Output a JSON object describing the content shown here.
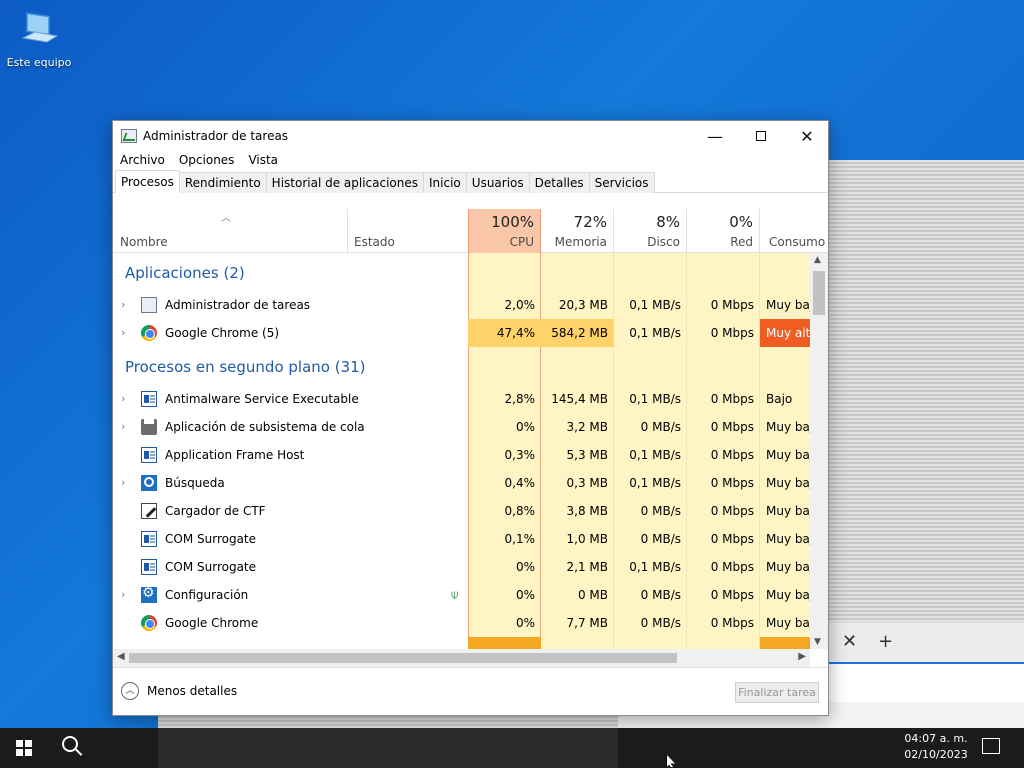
{
  "desktop": {
    "icon_label": "Este equipo"
  },
  "window": {
    "title": "Administrador de tareas",
    "min": "—",
    "close": "✕"
  },
  "menu": [
    "Archivo",
    "Opciones",
    "Vista"
  ],
  "tabs": [
    "Procesos",
    "Rendimiento",
    "Historial de aplicaciones",
    "Inicio",
    "Usuarios",
    "Detalles",
    "Servicios"
  ],
  "header": {
    "name": "Nombre",
    "estado": "Estado",
    "cpu_pct": "100%",
    "cpu": "CPU",
    "mem_pct": "72%",
    "mem": "Memoria",
    "disk_pct": "8%",
    "disk": "Disco",
    "net_pct": "0%",
    "net": "Red",
    "cons": "Consumo d"
  },
  "groups": {
    "apps": "Aplicaciones (2)",
    "bg": "Procesos en segundo plano (31)"
  },
  "apps": [
    {
      "name": "Administrador de tareas",
      "icon": "task-manager-icon",
      "cpu": "2,0%",
      "mem": "20,3 MB",
      "disk": "0,1 MB/s",
      "net": "0 Mbps",
      "cons": "Muy baja"
    },
    {
      "name": "Google Chrome (5)",
      "icon": "chrome-icon",
      "cpu": "47,4%",
      "mem": "584,2 MB",
      "disk": "0,1 MB/s",
      "net": "0 Mbps",
      "cons": "Muy alta"
    }
  ],
  "bg": [
    {
      "name": "Antimalware Service Executable",
      "icon": "window-icon",
      "cpu": "2,8%",
      "mem": "145,4 MB",
      "disk": "0,1 MB/s",
      "net": "0 Mbps",
      "cons": "Bajo"
    },
    {
      "name": "Aplicación de subsistema de cola",
      "icon": "printer-icon",
      "cpu": "0%",
      "mem": "3,2 MB",
      "disk": "0 MB/s",
      "net": "0 Mbps",
      "cons": "Muy baja"
    },
    {
      "name": "Application Frame Host",
      "icon": "window-icon",
      "cpu": "0,3%",
      "mem": "5,3 MB",
      "disk": "0,1 MB/s",
      "net": "0 Mbps",
      "cons": "Muy baja"
    },
    {
      "name": "Búsqueda",
      "icon": "search-icon",
      "cpu": "0,4%",
      "mem": "0,3 MB",
      "disk": "0,1 MB/s",
      "net": "0 Mbps",
      "cons": "Muy baja"
    },
    {
      "name": "Cargador de CTF",
      "icon": "pen-icon",
      "cpu": "0,8%",
      "mem": "3,8 MB",
      "disk": "0 MB/s",
      "net": "0 Mbps",
      "cons": "Muy baja"
    },
    {
      "name": "COM Surrogate",
      "icon": "window-icon",
      "cpu": "0,1%",
      "mem": "1,0 MB",
      "disk": "0 MB/s",
      "net": "0 Mbps",
      "cons": "Muy baja"
    },
    {
      "name": "COM Surrogate",
      "icon": "window-icon",
      "cpu": "0%",
      "mem": "2,1 MB",
      "disk": "0,1 MB/s",
      "net": "0 Mbps",
      "cons": "Muy baja"
    },
    {
      "name": "Configuración",
      "icon": "gear-icon",
      "cpu": "0%",
      "mem": "0 MB",
      "disk": "0 MB/s",
      "net": "0 Mbps",
      "cons": "Muy baja"
    },
    {
      "name": "Google Chrome",
      "icon": "chrome-icon",
      "cpu": "0%",
      "mem": "7,7 MB",
      "disk": "0 MB/s",
      "net": "0 Mbps",
      "cons": "Muy baja"
    }
  ],
  "footer": {
    "less": "Menos detalles",
    "end": "Finalizar tarea"
  },
  "taskbar": {
    "time": "04:07 a. m.",
    "date": "02/10/2023"
  },
  "bg_browser": {
    "close": "✕",
    "add": "+"
  }
}
